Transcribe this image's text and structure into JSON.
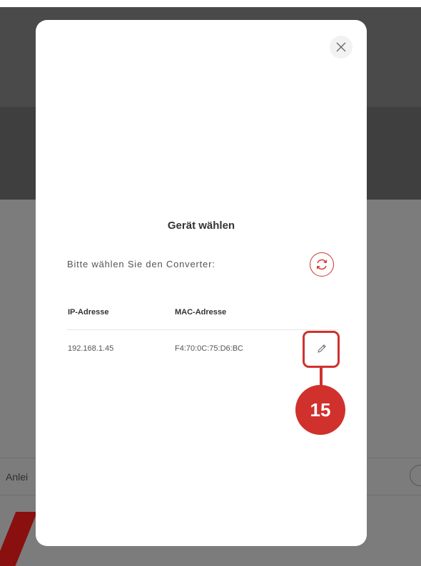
{
  "background": {
    "row_text": "Anlei"
  },
  "dialog": {
    "close_icon": "close-icon",
    "title": "Gerät wählen",
    "prompt": "Bitte wählen Sie den Converter:",
    "refresh_icon": "refresh-icon",
    "table": {
      "headers": [
        "IP-Adresse",
        "MAC-Adresse"
      ],
      "rows": [
        {
          "ip": "192.168.1.45",
          "mac": "F4:70:0C:75:D6:BC",
          "action_icon": "pencil-icon"
        }
      ]
    }
  },
  "callout": {
    "number": "15",
    "color": "#d0312d"
  },
  "colors": {
    "accent": "#d0312d",
    "overlay": "#7c7c7c",
    "modal_bg": "#ffffff"
  }
}
